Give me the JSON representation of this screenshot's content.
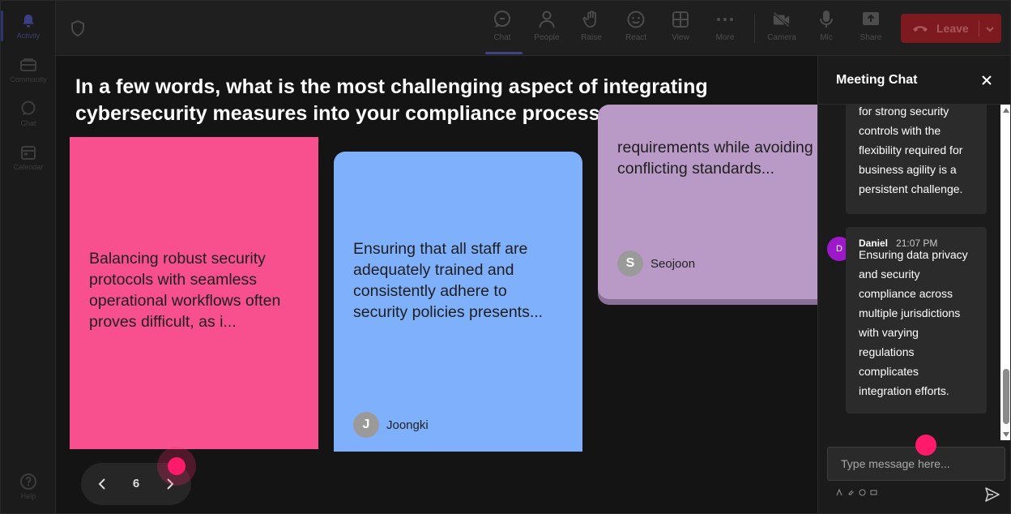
{
  "rail": {
    "items": [
      {
        "label": "Activity",
        "icon": "bell-icon",
        "active": true
      },
      {
        "label": "Community",
        "icon": "community-icon"
      },
      {
        "label": "Chat",
        "icon": "chat-icon"
      },
      {
        "label": "Calendar",
        "icon": "calendar-icon"
      }
    ],
    "help": {
      "label": "Help",
      "icon": "help-icon"
    }
  },
  "toolbar": {
    "items": [
      {
        "label": "Chat",
        "icon": "chat-icon",
        "active": true
      },
      {
        "label": "People",
        "icon": "people-icon"
      },
      {
        "label": "Raise",
        "icon": "hand-icon"
      },
      {
        "label": "React",
        "icon": "smiley-icon"
      },
      {
        "label": "View",
        "icon": "grid-icon"
      },
      {
        "label": "More",
        "icon": "ellipsis-icon"
      },
      {
        "label": "Camera",
        "icon": "camera-off-icon"
      },
      {
        "label": "Mic",
        "icon": "mic-icon"
      },
      {
        "label": "Share",
        "icon": "share-icon"
      }
    ],
    "leave_label": "Leave",
    "leave_color": "#7c1a1f"
  },
  "stage": {
    "question": "In a few words, what is the most challenging aspect of integrating cybersecurity measures into your compliance processes?",
    "cards": [
      {
        "text": "Balancing robust security protocols with seamless operational workflows often proves difficult, as i...",
        "author": "",
        "initial": "",
        "color": "#f8508f"
      },
      {
        "text": "Ensuring that all staff are adequately trained and consistently adhere to security policies presents...",
        "author": "Joongki",
        "initial": "J",
        "color": "#7fb0fb"
      },
      {
        "text": "requirements while avoiding conflicting standards...",
        "author": "Seojoon",
        "initial": "S",
        "color": "#b99ac6"
      }
    ],
    "pager": {
      "page": "6"
    }
  },
  "chat": {
    "title": "Meeting Chat",
    "messages": [
      {
        "text": "for strong security controls with the flexibility required for business agility is a persistent challenge."
      },
      {
        "sender": "Daniel",
        "initial": "D",
        "time": "21:07 PM",
        "text": "Ensuring data privacy and security compliance across multiple jurisdictions with varying regulations complicates integration efforts."
      }
    ],
    "input_placeholder": "Type message here..."
  }
}
